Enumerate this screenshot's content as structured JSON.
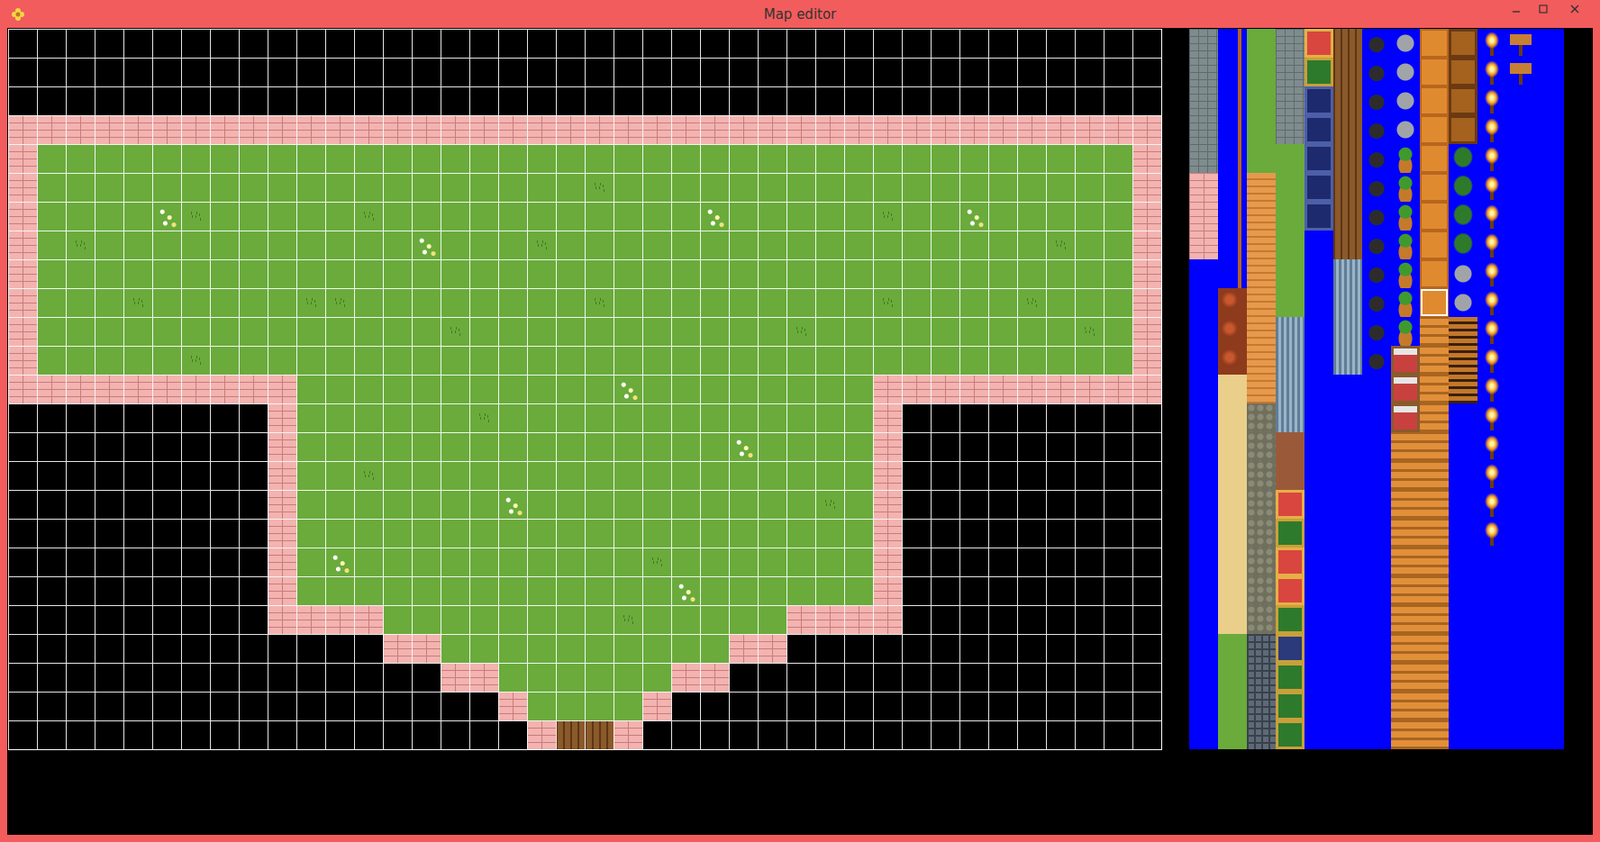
{
  "window": {
    "title": "Map editor"
  },
  "map": {
    "rows": [
      {
        "runs": [
          {
            "kind": "void",
            "count": 40
          }
        ]
      },
      {
        "runs": [
          {
            "kind": "void",
            "count": 40
          }
        ]
      },
      {
        "runs": [
          {
            "kind": "void",
            "count": 40
          }
        ]
      },
      {
        "runs": [
          {
            "kind": "brick",
            "count": 40
          }
        ]
      },
      {
        "runs": [
          {
            "kind": "brick",
            "count": 1
          },
          {
            "kind": "grass",
            "count": 38
          },
          {
            "kind": "brick",
            "count": 1
          }
        ]
      },
      {
        "runs": [
          {
            "kind": "brick",
            "count": 1
          },
          {
            "kind": "grass",
            "count": 19
          },
          {
            "kind": "tuft",
            "count": 1
          },
          {
            "kind": "grass",
            "count": 18
          },
          {
            "kind": "brick",
            "count": 1
          }
        ]
      },
      {
        "runs": [
          {
            "kind": "brick",
            "count": 1
          },
          {
            "kind": "grass",
            "count": 4
          },
          {
            "kind": "flower",
            "count": 1
          },
          {
            "kind": "tuft",
            "count": 1
          },
          {
            "kind": "grass",
            "count": 5
          },
          {
            "kind": "tuft",
            "count": 1
          },
          {
            "kind": "grass",
            "count": 11
          },
          {
            "kind": "flower",
            "count": 1
          },
          {
            "kind": "grass",
            "count": 5
          },
          {
            "kind": "tuft",
            "count": 1
          },
          {
            "kind": "grass",
            "count": 2
          },
          {
            "kind": "flower",
            "count": 1
          },
          {
            "kind": "grass",
            "count": 5
          },
          {
            "kind": "brick",
            "count": 1
          }
        ]
      },
      {
        "runs": [
          {
            "kind": "brick",
            "count": 1
          },
          {
            "kind": "grass",
            "count": 1
          },
          {
            "kind": "tuft",
            "count": 1
          },
          {
            "kind": "grass",
            "count": 11
          },
          {
            "kind": "flower",
            "count": 1
          },
          {
            "kind": "grass",
            "count": 3
          },
          {
            "kind": "tuft",
            "count": 1
          },
          {
            "kind": "grass",
            "count": 17
          },
          {
            "kind": "tuft",
            "count": 1
          },
          {
            "kind": "grass",
            "count": 2
          },
          {
            "kind": "brick",
            "count": 1
          }
        ]
      },
      {
        "runs": [
          {
            "kind": "brick",
            "count": 1
          },
          {
            "kind": "grass",
            "count": 38
          },
          {
            "kind": "brick",
            "count": 1
          }
        ]
      },
      {
        "runs": [
          {
            "kind": "brick",
            "count": 1
          },
          {
            "kind": "grass",
            "count": 3
          },
          {
            "kind": "tuft",
            "count": 1
          },
          {
            "kind": "grass",
            "count": 5
          },
          {
            "kind": "tuft",
            "count": 2
          },
          {
            "kind": "grass",
            "count": 8
          },
          {
            "kind": "tuft",
            "count": 1
          },
          {
            "kind": "grass",
            "count": 9
          },
          {
            "kind": "tuft",
            "count": 1
          },
          {
            "kind": "grass",
            "count": 4
          },
          {
            "kind": "tuft",
            "count": 1
          },
          {
            "kind": "grass",
            "count": 3
          },
          {
            "kind": "brick",
            "count": 1
          }
        ]
      },
      {
        "runs": [
          {
            "kind": "brick",
            "count": 1
          },
          {
            "kind": "grass",
            "count": 14
          },
          {
            "kind": "tuft",
            "count": 1
          },
          {
            "kind": "grass",
            "count": 11
          },
          {
            "kind": "tuft",
            "count": 1
          },
          {
            "kind": "grass",
            "count": 9
          },
          {
            "kind": "tuft",
            "count": 1
          },
          {
            "kind": "grass",
            "count": 1
          },
          {
            "kind": "brick",
            "count": 1
          }
        ]
      },
      {
        "runs": [
          {
            "kind": "brick",
            "count": 1
          },
          {
            "kind": "grass",
            "count": 5
          },
          {
            "kind": "tuft",
            "count": 1
          },
          {
            "kind": "grass",
            "count": 32
          },
          {
            "kind": "brick",
            "count": 1
          }
        ]
      },
      {
        "runs": [
          {
            "kind": "brick",
            "count": 10
          },
          {
            "kind": "grass",
            "count": 11
          },
          {
            "kind": "flower",
            "count": 1
          },
          {
            "kind": "grass",
            "count": 8
          },
          {
            "kind": "brick",
            "count": 10
          }
        ]
      },
      {
        "runs": [
          {
            "kind": "void",
            "count": 9
          },
          {
            "kind": "brick",
            "count": 1
          },
          {
            "kind": "grass",
            "count": 6
          },
          {
            "kind": "tuft",
            "count": 1
          },
          {
            "kind": "grass",
            "count": 13
          },
          {
            "kind": "brick",
            "count": 1
          },
          {
            "kind": "void",
            "count": 9
          }
        ]
      },
      {
        "runs": [
          {
            "kind": "void",
            "count": 9
          },
          {
            "kind": "brick",
            "count": 1
          },
          {
            "kind": "grass",
            "count": 15
          },
          {
            "kind": "flower",
            "count": 1
          },
          {
            "kind": "grass",
            "count": 4
          },
          {
            "kind": "brick",
            "count": 1
          },
          {
            "kind": "void",
            "count": 9
          }
        ]
      },
      {
        "runs": [
          {
            "kind": "void",
            "count": 9
          },
          {
            "kind": "brick",
            "count": 1
          },
          {
            "kind": "grass",
            "count": 2
          },
          {
            "kind": "tuft",
            "count": 1
          },
          {
            "kind": "grass",
            "count": 17
          },
          {
            "kind": "brick",
            "count": 1
          },
          {
            "kind": "void",
            "count": 9
          }
        ]
      },
      {
        "runs": [
          {
            "kind": "void",
            "count": 9
          },
          {
            "kind": "brick",
            "count": 1
          },
          {
            "kind": "grass",
            "count": 7
          },
          {
            "kind": "flower",
            "count": 1
          },
          {
            "kind": "grass",
            "count": 10
          },
          {
            "kind": "tuft",
            "count": 1
          },
          {
            "kind": "grass",
            "count": 1
          },
          {
            "kind": "brick",
            "count": 1
          },
          {
            "kind": "void",
            "count": 9
          }
        ]
      },
      {
        "runs": [
          {
            "kind": "void",
            "count": 9
          },
          {
            "kind": "brick",
            "count": 1
          },
          {
            "kind": "grass",
            "count": 20
          },
          {
            "kind": "brick",
            "count": 1
          },
          {
            "kind": "void",
            "count": 9
          }
        ]
      },
      {
        "runs": [
          {
            "kind": "void",
            "count": 9
          },
          {
            "kind": "brick",
            "count": 1
          },
          {
            "kind": "grass",
            "count": 1
          },
          {
            "kind": "flower",
            "count": 1
          },
          {
            "kind": "grass",
            "count": 10
          },
          {
            "kind": "tuft",
            "count": 1
          },
          {
            "kind": "grass",
            "count": 7
          },
          {
            "kind": "brick",
            "count": 1
          },
          {
            "kind": "void",
            "count": 9
          }
        ]
      },
      {
        "runs": [
          {
            "kind": "void",
            "count": 9
          },
          {
            "kind": "brick",
            "count": 1
          },
          {
            "kind": "grass",
            "count": 13
          },
          {
            "kind": "flower",
            "count": 1
          },
          {
            "kind": "grass",
            "count": 6
          },
          {
            "kind": "brick",
            "count": 1
          },
          {
            "kind": "void",
            "count": 9
          }
        ]
      },
      {
        "runs": [
          {
            "kind": "void",
            "count": 9
          },
          {
            "kind": "brick",
            "count": 4
          },
          {
            "kind": "grass",
            "count": 8
          },
          {
            "kind": "tuft",
            "count": 1
          },
          {
            "kind": "grass",
            "count": 5
          },
          {
            "kind": "brick",
            "count": 4
          },
          {
            "kind": "void",
            "count": 9
          }
        ]
      },
      {
        "runs": [
          {
            "kind": "void",
            "count": 13
          },
          {
            "kind": "brick",
            "count": 2
          },
          {
            "kind": "grass",
            "count": 10
          },
          {
            "kind": "brick",
            "count": 2
          },
          {
            "kind": "void",
            "count": 13
          }
        ]
      },
      {
        "runs": [
          {
            "kind": "void",
            "count": 15
          },
          {
            "kind": "brick",
            "count": 2
          },
          {
            "kind": "grass",
            "count": 6
          },
          {
            "kind": "brick",
            "count": 2
          },
          {
            "kind": "void",
            "count": 15
          }
        ]
      },
      {
        "runs": [
          {
            "kind": "void",
            "count": 17
          },
          {
            "kind": "brick",
            "count": 1
          },
          {
            "kind": "grass",
            "count": 4
          },
          {
            "kind": "brick",
            "count": 1
          },
          {
            "kind": "void",
            "count": 17
          }
        ]
      },
      {
        "runs": [
          {
            "kind": "void",
            "count": 18
          },
          {
            "kind": "brick",
            "count": 1
          },
          {
            "kind": "door",
            "count": 2
          },
          {
            "kind": "brick",
            "count": 1
          },
          {
            "kind": "void",
            "count": 18
          }
        ]
      }
    ]
  },
  "palette": {
    "columns": [
      {
        "runs": [
          {
            "kind": "stone",
            "count": 5,
            "selected": false
          },
          {
            "kind": "brick",
            "count": 3,
            "selected": false
          },
          {
            "kind": "empty",
            "count": 17,
            "selected": false
          }
        ]
      },
      {
        "runs": [
          {
            "kind": "cliff",
            "count": 9,
            "selected": false
          },
          {
            "kind": "lava",
            "count": 3,
            "selected": false
          },
          {
            "kind": "sand",
            "count": 9,
            "selected": false
          },
          {
            "kind": "grass",
            "count": 4,
            "selected": false
          }
        ]
      },
      {
        "runs": [
          {
            "kind": "grass",
            "count": 5,
            "selected": false
          },
          {
            "kind": "wood",
            "count": 8,
            "selected": false
          },
          {
            "kind": "cobble",
            "count": 8,
            "selected": false
          },
          {
            "kind": "grate",
            "count": 4,
            "selected": false
          }
        ]
      },
      {
        "runs": [
          {
            "kind": "stone",
            "count": 4,
            "selected": false
          },
          {
            "kind": "grass",
            "count": 6,
            "selected": false
          },
          {
            "kind": "pipe",
            "count": 4,
            "selected": false
          },
          {
            "kind": "rug",
            "count": 2,
            "selected": false
          },
          {
            "kind": "carpet-red",
            "count": 1,
            "selected": false
          },
          {
            "kind": "carpet-green",
            "count": 1,
            "selected": false
          },
          {
            "kind": "carpet-red",
            "count": 2,
            "selected": false
          },
          {
            "kind": "carpet-green",
            "count": 1,
            "selected": false
          },
          {
            "kind": "carpet-navy",
            "count": 1,
            "selected": false
          },
          {
            "kind": "carpet-green",
            "count": 3,
            "selected": false
          }
        ]
      },
      {
        "runs": [
          {
            "kind": "carpet-red",
            "count": 1,
            "selected": false
          },
          {
            "kind": "carpet-green",
            "count": 1,
            "selected": false
          },
          {
            "kind": "frame",
            "count": 5,
            "selected": false
          },
          {
            "kind": "empty",
            "count": 18,
            "selected": false
          }
        ]
      },
      {
        "runs": [
          {
            "kind": "door",
            "count": 8,
            "selected": false
          },
          {
            "kind": "pipe",
            "count": 4,
            "selected": false
          },
          {
            "kind": "empty",
            "count": 13,
            "selected": false
          }
        ]
      },
      {
        "runs": [
          {
            "kind": "pot",
            "count": 12,
            "selected": false
          },
          {
            "kind": "empty",
            "count": 13,
            "selected": false
          }
        ]
      },
      {
        "runs": [
          {
            "kind": "statue",
            "count": 4,
            "selected": false
          },
          {
            "kind": "plant",
            "count": 7,
            "selected": false
          },
          {
            "kind": "bed",
            "count": 3,
            "selected": false
          },
          {
            "kind": "furniture",
            "count": 11,
            "selected": false
          }
        ]
      },
      {
        "runs": [
          {
            "kind": "table",
            "count": 9,
            "selected": false
          },
          {
            "kind": "table",
            "count": 1,
            "selected": true
          },
          {
            "kind": "furniture",
            "count": 15,
            "selected": false
          }
        ]
      },
      {
        "runs": [
          {
            "kind": "chest",
            "count": 4,
            "selected": false
          },
          {
            "kind": "tree",
            "count": 4,
            "selected": false
          },
          {
            "kind": "statue",
            "count": 2,
            "selected": false
          },
          {
            "kind": "shelf",
            "count": 3,
            "selected": false
          },
          {
            "kind": "empty",
            "count": 12,
            "selected": false
          }
        ]
      },
      {
        "runs": [
          {
            "kind": "torch",
            "count": 18,
            "selected": false
          },
          {
            "kind": "empty",
            "count": 7,
            "selected": false
          }
        ]
      },
      {
        "runs": [
          {
            "kind": "sign",
            "count": 2,
            "selected": false
          },
          {
            "kind": "empty",
            "count": 23,
            "selected": false
          }
        ]
      },
      {
        "runs": [
          {
            "kind": "empty",
            "count": 25,
            "selected": false
          }
        ]
      }
    ]
  }
}
